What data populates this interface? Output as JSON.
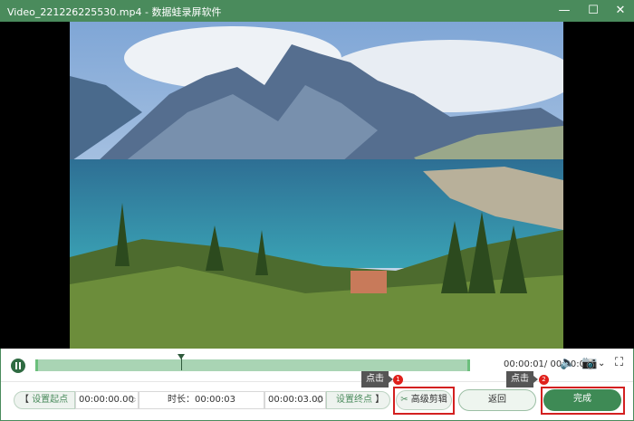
{
  "window": {
    "title": "Video_221226225530.mp4  -  数据蛙录屏软件",
    "minimize": "—",
    "maximize": "☐",
    "close": "✕"
  },
  "player": {
    "progress": 0.333,
    "time": "00:00:01/ 00:00:03",
    "icons": [
      "pause-icon",
      "volume-icon",
      "camera-icon",
      "chevron-down-icon",
      "fullscreen-icon"
    ]
  },
  "trim": {
    "set_start": "设置起点",
    "start_time": "00:00:00.00",
    "duration": "时长：00:00:03",
    "end_time": "00:00:03.00",
    "set_end": "设置终点",
    "start_bracket": "【",
    "end_bracket": "】"
  },
  "actions": {
    "advanced": "高级剪辑",
    "back": "返回",
    "done": "完成"
  },
  "annotations": [
    {
      "label": "点击",
      "badge": "1"
    },
    {
      "label": "点击",
      "badge": "2"
    }
  ],
  "colors": {
    "accent": "#4a8b5c",
    "highlight": "#d32020"
  }
}
